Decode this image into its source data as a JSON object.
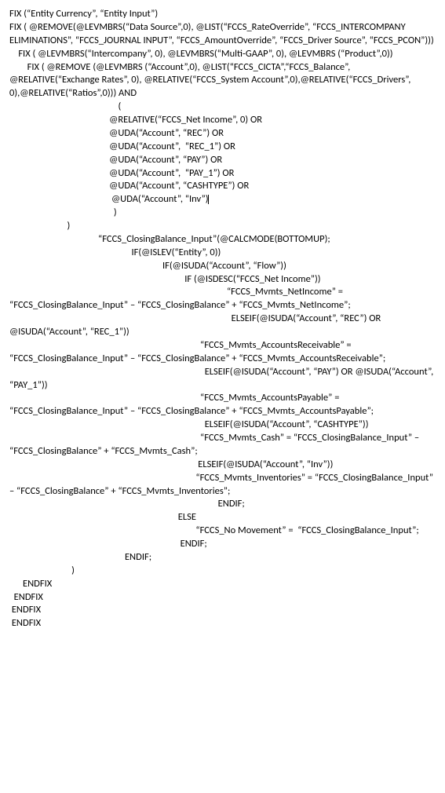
{
  "lines": {
    "l0": "FIX (“Entity Currency”, “Entity Input”)",
    "l1": "",
    "l2": "FIX ( @REMOVE(@LEVMBRS(“Data Source”,0), @LIST(“FCCS_RateOverride”, “FCCS_INTERCOMPANY ELIMINATIONS”, “FCCS_JOURNAL INPUT”, “FCCS_AmountOverride”, “FCCS_Driver Source”, “FCCS_PCON”)))",
    "l3": "    FIX ( @LEVMBRS(“Intercompany”, 0), @LEVMBRS(“Multi-GAAP”, 0), @LEVMBRS (“Product”,0))",
    "l4": "        FIX ( @REMOVE (@LEVMBRS (“Account”,0), @LIST(“FCCS_CICTA”,“FCCS_Balance”, @RELATIVE(“Exchange Rates”, 0), @RELATIVE(“FCCS_System Account”,0),@RELATIVE(“FCCS_Drivers”, 0),@RELATIVE(“Ratios”,0))) AND",
    "l5": "",
    "l6": "                                                 (",
    "l7": "",
    "l8": "                                             @RELATIVE(“FCCS_Net Income”, 0) OR",
    "l9": "                                             @UDA(“Account”, “REC”) OR",
    "l10": "                                             @UDA(“Account”,  “REC_1”) OR",
    "l11": "                                             @UDA(“Account”, “PAY”) OR",
    "l12": "                                             @UDA(“Account”,  “PAY_1”) OR",
    "l13": "                                             @UDA(“Account”, “CASHTYPE”) OR",
    "l14": "                                              @UDA(“Account”, “Inv”)",
    "l15": "                                               )",
    "l16": "                          )",
    "l17": "                                        “FCCS_ClosingBalance_Input”(@CALCMODE(BOTTOMUP);",
    "l18": "",
    "l19": "                                                       IF(@ISLEV(“Entity”, 0))",
    "l20": "                                                                     IF(@ISUDA(“Account”, “Flow”))",
    "l21": "                                                                               IF (@ISDESC(“FCCS_Net Income”))",
    "l22": "                                                                                                  “FCCS_Mvmts_NetIncome” = “FCCS_ClosingBalance_Input” – “FCCS_ClosingBalance” + “FCCS_Mvmts_NetIncome”;",
    "l23": "                                                                                                    ELSEIF(@ISUDA(“Account”, “REC”) OR @ISUDA(“Account”, “REC_1”))",
    "l24": "                                                                                      “FCCS_Mvmts_AccountsReceivable” = “FCCS_ClosingBalance_Input” – “FCCS_ClosingBalance” + “FCCS_Mvmts_AccountsReceivable”;",
    "l25": "                                                                                        ELSEIF(@ISUDA(“Account”, “PAY”) OR @ISUDA(“Account”,  “PAY_1”))",
    "l26": "                                                                                      “FCCS_Mvmts_AccountsPayable” = “FCCS_ClosingBalance_Input” – “FCCS_ClosingBalance” + “FCCS_Mvmts_AccountsPayable”;",
    "l27": "                                                                                        ELSEIF(@ISUDA(“Account”, “CASHTYPE”))",
    "l28": "                                                                                      “FCCS_Mvmts_Cash” = “FCCS_ClosingBalance_Input” – “FCCS_ClosingBalance” + “FCCS_Mvmts_Cash”;",
    "l29": "                                                                                     ELSEIF(@ISUDA(“Account”, “Inv”))",
    "l30": "                                                                                    “FCCS_Mvmts_Inventories” = “FCCS_ClosingBalance_Input” – “FCCS_ClosingBalance” + “FCCS_Mvmts_Inventories”;",
    "l31": "                                                                                              ENDIF;",
    "l32": "                                                                            ELSE",
    "l33": "                                                                                    “FCCS_No Movement” =  “FCCS_ClosingBalance_Input”;",
    "l34": "                                                                             ENDIF;",
    "l35": "",
    "l36": "                                                    ENDIF;",
    "l37": "                            )",
    "l38": "      ENDFIX",
    "l39": "  ENDFIX",
    "l40": "",
    "l41": " ENDFIX",
    "l42": " ENDFIX"
  }
}
